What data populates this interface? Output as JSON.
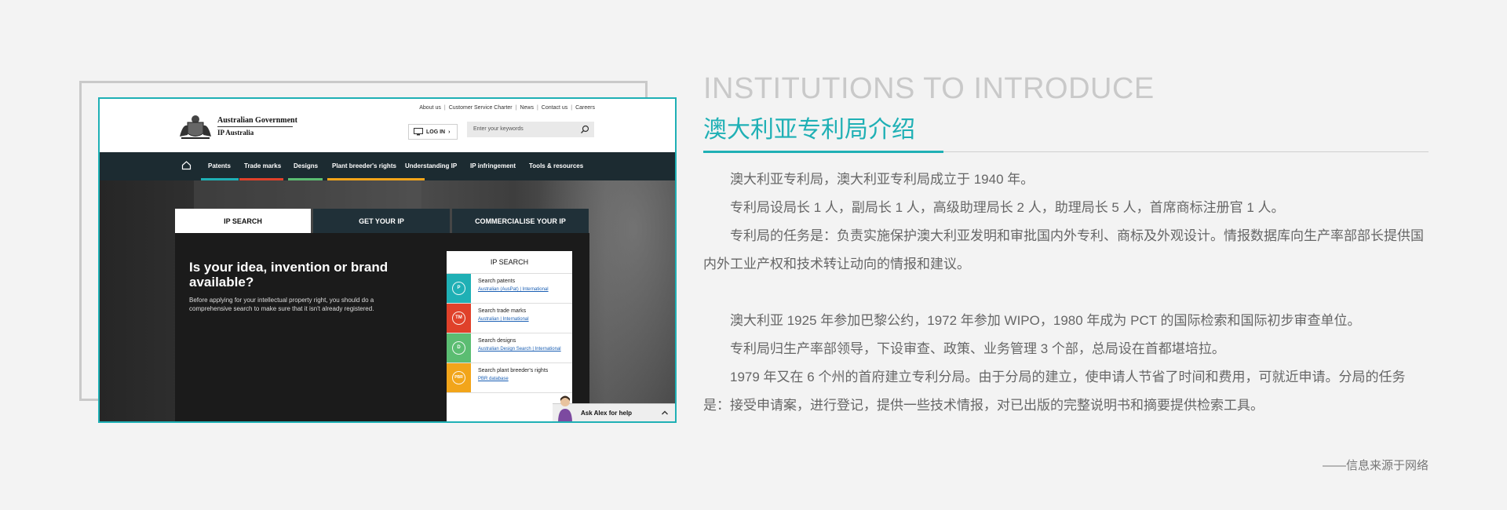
{
  "screenshot": {
    "gov_name": "Australian Government",
    "gov_sub": "IP Australia",
    "util_links": [
      "About us",
      "Customer Service Charter",
      "News",
      "Contact us",
      "Careers"
    ],
    "login_label": "LOG IN",
    "search_placeholder": "Enter your keywords",
    "nav": [
      "Patents",
      "Trade marks",
      "Designs",
      "Plant breeder's rights",
      "Understanding IP",
      "IP infringement",
      "Tools & resources"
    ],
    "nav_colors": {
      "patents": "#1fb0b5",
      "trade_marks": "#e0412a",
      "designs": "#5bbd72",
      "pbr": "#f2a51a"
    },
    "tabs": [
      "IP SEARCH",
      "GET YOUR IP",
      "COMMERCIALISE YOUR IP"
    ],
    "hero_title": "Is your idea, invention or brand available?",
    "hero_text": "Before applying for your intellectual property right, you should do a comprehensive search to make sure that it isn't already registered.",
    "search_box": {
      "title": "IP SEARCH",
      "rows": [
        {
          "badge": "P",
          "color": "#1fb0b5",
          "title": "Search patents",
          "links": "Australian (AusPat) | International"
        },
        {
          "badge": "TM",
          "color": "#e0412a",
          "title": "Search trade marks",
          "links": "Australian | International"
        },
        {
          "badge": "D",
          "color": "#5bbd72",
          "title": "Search designs",
          "links": "Australian Design Search | International"
        },
        {
          "badge": "PBR",
          "color": "#f2a51a",
          "title": "Search plant breeder's rights",
          "links": "PBR database"
        }
      ]
    },
    "alex_label": "Ask Alex for help"
  },
  "content": {
    "en_title": "INSTITUTIONS TO INTRODUCE",
    "cn_title": "澳大利亚专利局介绍",
    "paragraphs": [
      "　　澳大利亚专利局，澳大利亚专利局成立于 1940 年。",
      "　　专利局设局长 1 人，副局长 1 人，高级助理局长 2 人，助理局长 5 人，首席商标注册官 1 人。",
      "　　专利局的任务是：负责实施保护澳大利亚发明和审批国内外专利、商标及外观设计。情报数据库向生产率部部长提供国内外工业产权和技术转让动向的情报和建议。",
      "　　澳大利亚 1925 年参加巴黎公约，1972 年参加 WIPO，1980 年成为 PCT 的国际检索和国际初步审查单位。",
      "　　专利局归生产率部领导，下设审查、政策、业务管理 3 个部，总局设在首都堪培拉。",
      "　　1979 年又在 6 个州的首府建立专利分局。由于分局的建立，使申请人节省了时间和费用，可就近申请。分局的任务是：接受申请案，进行登记，提供一些技术情报，对已出版的完整说明书和摘要提供检索工具。"
    ],
    "source": "——信息来源于网络"
  },
  "colors": {
    "accent": "#1fb0b5",
    "body_text": "#666666",
    "title_gray": "#c9c9c9"
  }
}
